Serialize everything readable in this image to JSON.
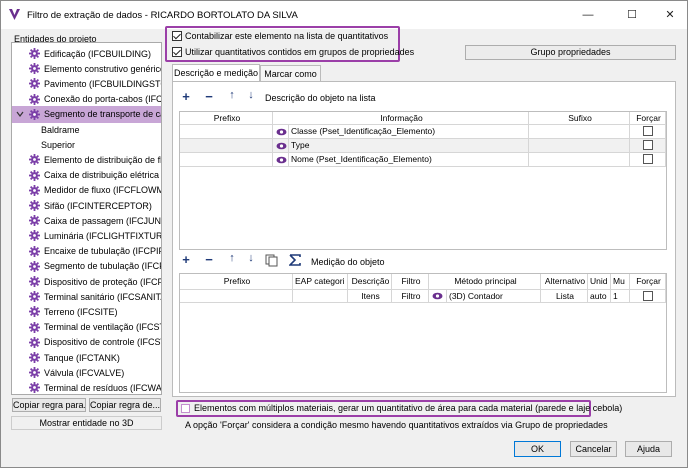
{
  "window": {
    "title": "Filtro de extração de dados - RICARDO BORTOLATO DA SILVA",
    "minimize": "—",
    "maximize": "☐",
    "close": "✕"
  },
  "left": {
    "label": "Entidades do projeto",
    "items": [
      {
        "label": "Edificação (IFCBUILDING)"
      },
      {
        "label": "Elemento construtivo genérico (I"
      },
      {
        "label": "Pavimento (IFCBUILDINGSTOREY"
      },
      {
        "label": "Conexão do porta-cabos (IFCCAI"
      },
      {
        "label": "Segmento de transporte de cabo"
      },
      {
        "label": "Baldrame"
      },
      {
        "label": "Superior"
      },
      {
        "label": "Elemento de distribuição de flux"
      },
      {
        "label": "Caixa de distribuição elétrica (IFC"
      },
      {
        "label": "Medidor de fluxo (IFCFLOWMETI"
      },
      {
        "label": "Sifão (IFCINTERCEPTOR)"
      },
      {
        "label": "Caixa de passagem (IFCJUNCTIO"
      },
      {
        "label": "Luminária (IFCLIGHTFIXTURE)"
      },
      {
        "label": "Encaixe de tubulação (IFCPIPEFIT"
      },
      {
        "label": "Segmento de tubulação (IFCPIPE"
      },
      {
        "label": "Dispositivo de proteção (IFCPRO"
      },
      {
        "label": "Terminal sanitário (IFCSANITARY"
      },
      {
        "label": "Terreno (IFCSITE)"
      },
      {
        "label": "Terminal de ventilação (IFCSTACI"
      },
      {
        "label": "Dispositivo de controle (IFCSWIT"
      },
      {
        "label": "Tanque (IFCTANK)"
      },
      {
        "label": "Válvula (IFCVALVE)"
      },
      {
        "label": "Terminal de resíduos (IFCWASTE"
      }
    ],
    "copy_rule_to": "Copiar regra para...",
    "copy_rule_from": "Copiar regra de...",
    "show_3d": "Mostrar entidade no 3D"
  },
  "options": {
    "count_label": "Contabilizar este elemento na lista de quantitativos",
    "count_checked": true,
    "use_groups_label": "Utilizar quantitativos contidos em grupos de propriedades",
    "use_groups_checked": true,
    "group_props_button": "Grupo propriedades"
  },
  "tabs": [
    {
      "label": "Descrição e medição"
    },
    {
      "label": "Marcar como"
    }
  ],
  "description": {
    "toolbar_label": "Descrição do objeto na lista",
    "headers": [
      "Prefixo",
      "Informação",
      "Sufixo",
      "Forçar"
    ],
    "rows": [
      {
        "info": "Classe (Pset_Identificação_Elemento)"
      },
      {
        "info": "Type"
      },
      {
        "info": "Nome (Pset_Identificação_Elemento)"
      }
    ]
  },
  "measurement": {
    "toolbar_label": "Medição do objeto",
    "headers": [
      "Prefixo",
      "EAP categori",
      "Descrição",
      "Filtro",
      "Método principal",
      "Alternativo",
      "Unid",
      "Mu",
      "Forçar"
    ],
    "row": {
      "prefix": "",
      "eap": "",
      "description": "Itens",
      "filter": "Filtro",
      "method": "(3D) Contador",
      "alternative": "Lista",
      "unit": "auto",
      "mult": "1"
    }
  },
  "materials_option": "Elementos com múltiplos materiais, gerar um quantitativo de área para cada material (parede e laje cebola)",
  "note": "A opção 'Forçar' considera a condição mesmo havendo quantitativos extraídos via Grupo de propriedades",
  "buttons": {
    "ok": "OK",
    "cancel": "Cancelar",
    "help": "Ajuda"
  },
  "colors": {
    "highlight": "#9b3fa8",
    "selection": "#c8a6d6",
    "gear": "#7b3fa8",
    "toolbar_icon": "#1f3a78"
  }
}
